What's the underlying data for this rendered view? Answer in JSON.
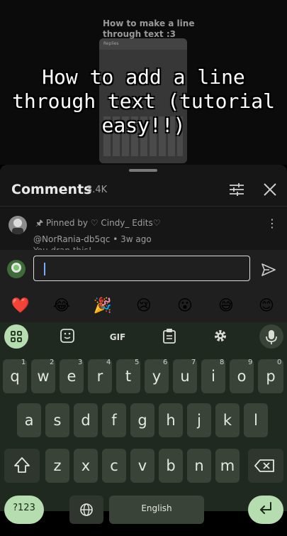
{
  "video": {
    "background_title": "How to make a line through text :3",
    "phone_header": "Replies",
    "overlay_lines": [
      "How to add  a line",
      "through text (tutorial",
      "easy!!)"
    ]
  },
  "comments": {
    "title": "Comments",
    "count": "3.4K",
    "pinned_text": "Pinned by ♡ Cindy_ Edits♡",
    "pinned_icon": "pin-icon",
    "handle": "@NorRania-db5qc • 3w ago",
    "cut_text": "You dran this!",
    "more": "⋮"
  },
  "input": {
    "value": "",
    "caret": "|"
  },
  "emoji_bar": [
    "❤️",
    "😂",
    "🎉",
    "😢",
    "😮",
    "😅",
    "😊"
  ],
  "keyboard": {
    "toolbar_gif": "GIF",
    "row1": [
      "q",
      "w",
      "e",
      "r",
      "t",
      "y",
      "u",
      "i",
      "o",
      "p"
    ],
    "row1_digits": [
      "1",
      "2",
      "3",
      "4",
      "5",
      "6",
      "7",
      "8",
      "9",
      "0"
    ],
    "row2": [
      "a",
      "s",
      "d",
      "f",
      "g",
      "h",
      "j",
      "k",
      "l"
    ],
    "row3": [
      "z",
      "x",
      "c",
      "v",
      "b",
      "n",
      "m"
    ],
    "sym_label": "?123",
    "space_label": "English"
  },
  "colors": {
    "accent": "#b6ddb0",
    "key": "#3a4338",
    "keyboard_bg": "#202920",
    "panel_bg": "#161616"
  }
}
